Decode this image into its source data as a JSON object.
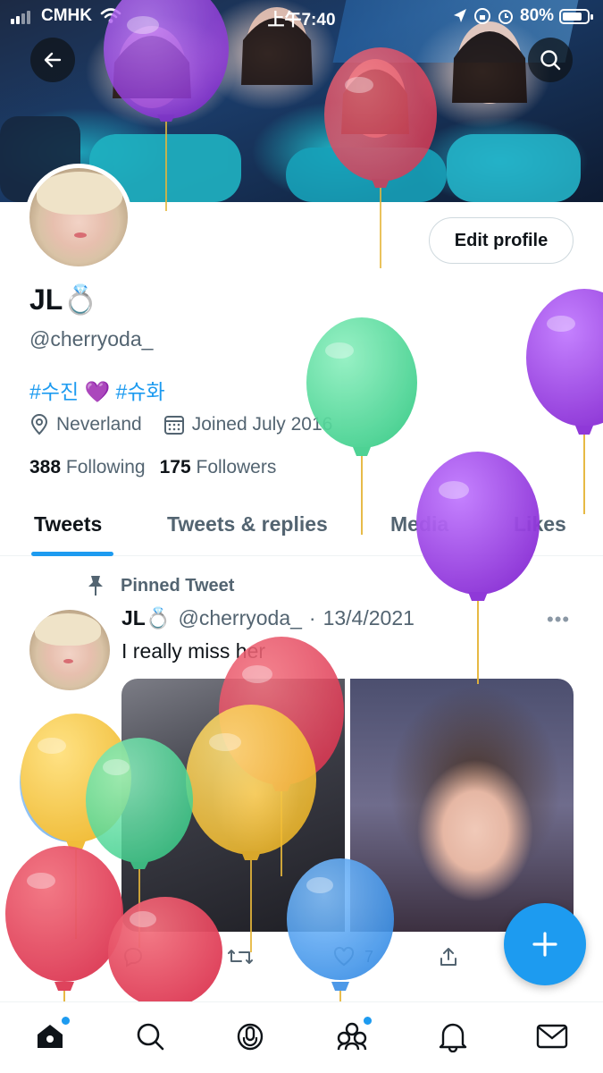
{
  "status_bar": {
    "carrier": "CMHK",
    "time": "上午7:40",
    "battery": "80%",
    "battery_level": 0.8
  },
  "profile": {
    "display_name": "JL💍",
    "handle": "@cherryoda_",
    "bio_tag1": "#수진",
    "bio_emoji": "💜",
    "bio_tag2": "#슈화",
    "location": "Neverland",
    "joined": "Joined July 2016",
    "following_count": "388",
    "following_label": "Following",
    "followers_count": "175",
    "followers_label": "Followers",
    "edit_profile_label": "Edit profile"
  },
  "tabs": [
    {
      "label": "Tweets",
      "active": true
    },
    {
      "label": "Tweets & replies",
      "active": false
    },
    {
      "label": "Media",
      "active": false
    },
    {
      "label": "Likes",
      "active": false
    }
  ],
  "tweet": {
    "pinned_label": "Pinned Tweet",
    "author_name": "JL💍",
    "author_handle": "@cherryoda_",
    "separator": "·",
    "date": "13/4/2021",
    "text": "I really miss her",
    "like_count": "7",
    "more_label": "•••"
  },
  "icons": {
    "back": "back-arrow-icon",
    "search": "search-icon",
    "location": "location-pin-icon",
    "calendar": "calendar-icon",
    "pin": "pin-icon",
    "reply": "reply-icon",
    "retweet": "retweet-icon",
    "like": "heart-icon",
    "share": "share-icon",
    "compose": "compose-plus-icon",
    "nav": [
      "home-icon",
      "search-icon",
      "spaces-icon",
      "communities-icon",
      "notifications-icon",
      "messages-icon"
    ]
  },
  "colors": {
    "accent": "#1d9bf0",
    "text": "#0f1419",
    "muted": "#536471",
    "balloon_purple": "#9b3fe0",
    "balloon_red": "#e8455e",
    "balloon_green": "#52d69a",
    "balloon_yellow": "#f5c533",
    "balloon_blue": "#4aa0ee"
  }
}
